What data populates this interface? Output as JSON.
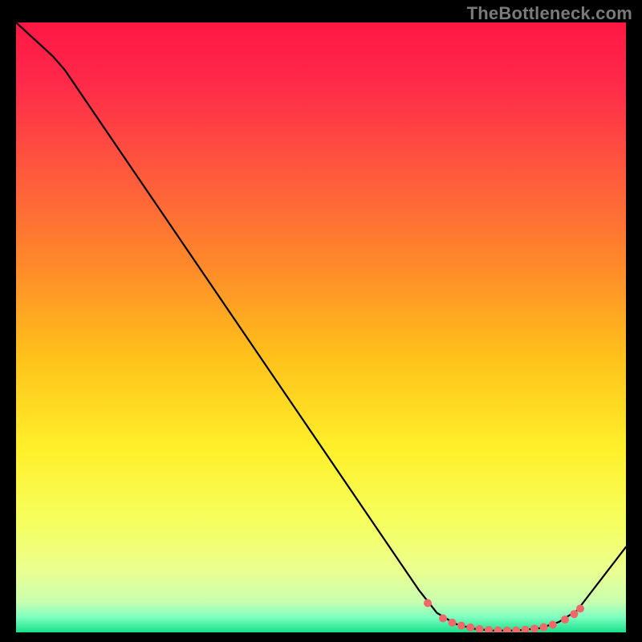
{
  "attribution": "TheBottleneck.com",
  "chart_data": {
    "type": "line",
    "title": "",
    "xlabel": "",
    "ylabel": "",
    "xlim": [
      0,
      100
    ],
    "ylim": [
      0,
      100
    ],
    "gradient_stops": [
      {
        "offset": 0.0,
        "color": "#ff1744"
      },
      {
        "offset": 0.1,
        "color": "#ff2a4a"
      },
      {
        "offset": 0.25,
        "color": "#ff5a3c"
      },
      {
        "offset": 0.4,
        "color": "#ff8a2a"
      },
      {
        "offset": 0.55,
        "color": "#ffc21a"
      },
      {
        "offset": 0.7,
        "color": "#fff02a"
      },
      {
        "offset": 0.82,
        "color": "#f6ff60"
      },
      {
        "offset": 0.9,
        "color": "#eaff90"
      },
      {
        "offset": 0.95,
        "color": "#c8ffb0"
      },
      {
        "offset": 0.975,
        "color": "#7effc0"
      },
      {
        "offset": 1.0,
        "color": "#18e08c"
      }
    ],
    "curve": [
      {
        "x": 0,
        "y": 100
      },
      {
        "x": 6,
        "y": 94.5
      },
      {
        "x": 8,
        "y": 92.2
      },
      {
        "x": 66,
        "y": 7.0
      },
      {
        "x": 69,
        "y": 3.2
      },
      {
        "x": 72,
        "y": 1.4
      },
      {
        "x": 75,
        "y": 0.6
      },
      {
        "x": 78,
        "y": 0.3
      },
      {
        "x": 82,
        "y": 0.3
      },
      {
        "x": 86,
        "y": 0.7
      },
      {
        "x": 89,
        "y": 1.7
      },
      {
        "x": 92,
        "y": 3.6
      },
      {
        "x": 100,
        "y": 14.0
      }
    ],
    "markers": [
      {
        "x": 67.5,
        "y": 4.8
      },
      {
        "x": 70.0,
        "y": 2.3
      },
      {
        "x": 71.5,
        "y": 1.6
      },
      {
        "x": 73.0,
        "y": 1.1
      },
      {
        "x": 74.5,
        "y": 0.8
      },
      {
        "x": 76.0,
        "y": 0.55
      },
      {
        "x": 77.5,
        "y": 0.4
      },
      {
        "x": 79.0,
        "y": 0.33
      },
      {
        "x": 80.5,
        "y": 0.3
      },
      {
        "x": 82.0,
        "y": 0.33
      },
      {
        "x": 83.5,
        "y": 0.42
      },
      {
        "x": 85.0,
        "y": 0.6
      },
      {
        "x": 86.5,
        "y": 0.85
      },
      {
        "x": 88.0,
        "y": 1.25
      },
      {
        "x": 90.0,
        "y": 2.1
      },
      {
        "x": 91.5,
        "y": 3.0
      },
      {
        "x": 92.5,
        "y": 3.9
      }
    ],
    "marker_color": "#f06868",
    "marker_radius": 5,
    "line_color": "#000000",
    "line_width": 2.2
  }
}
